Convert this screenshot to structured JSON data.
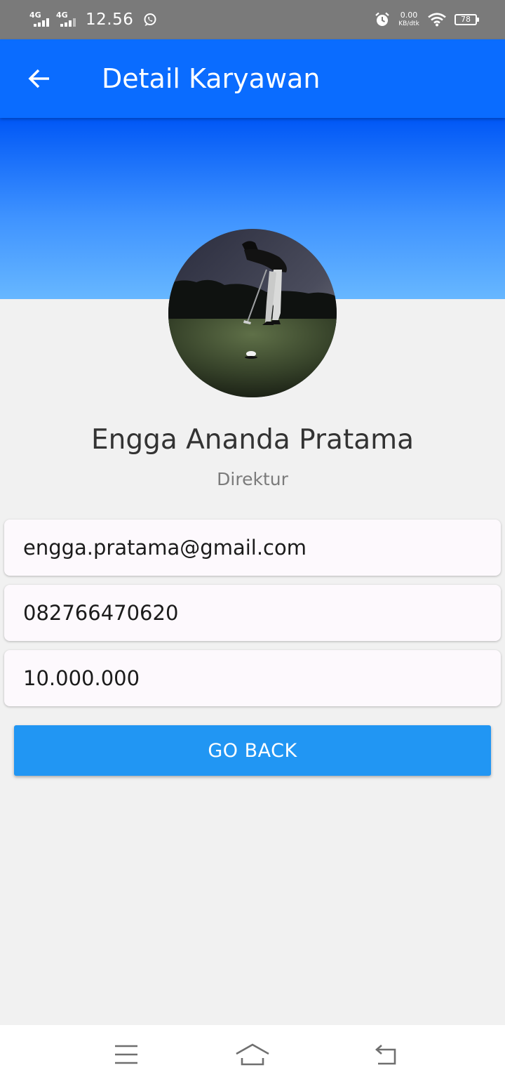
{
  "status_bar": {
    "network_1": "4G",
    "network_2": "4G",
    "time": "12.56",
    "speed_value": "0.00",
    "speed_unit": "KB/dtk",
    "battery": "78"
  },
  "app_bar": {
    "title": "Detail Karyawan"
  },
  "profile": {
    "name": "Engga Ananda Pratama",
    "role": "Direktur"
  },
  "details": {
    "email": "engga.pratama@gmail.com",
    "phone": "082766470620",
    "salary": "10.000.000"
  },
  "actions": {
    "go_back_label": "GO BACK"
  },
  "colors": {
    "status_bar": "#7a7a7a",
    "app_bar": "#0a6cff",
    "banner_top": "#0057f6",
    "banner_bottom": "#67b7ff",
    "button": "#2196f3",
    "background": "#f1f1f1",
    "card": "#fdf9fd"
  },
  "icons": {
    "back": "arrow-left-icon",
    "whatsapp": "whatsapp-icon",
    "alarm": "alarm-icon",
    "wifi": "wifi-icon",
    "nav_menu": "menu-icon",
    "nav_home": "home-icon",
    "nav_back": "back-icon"
  }
}
